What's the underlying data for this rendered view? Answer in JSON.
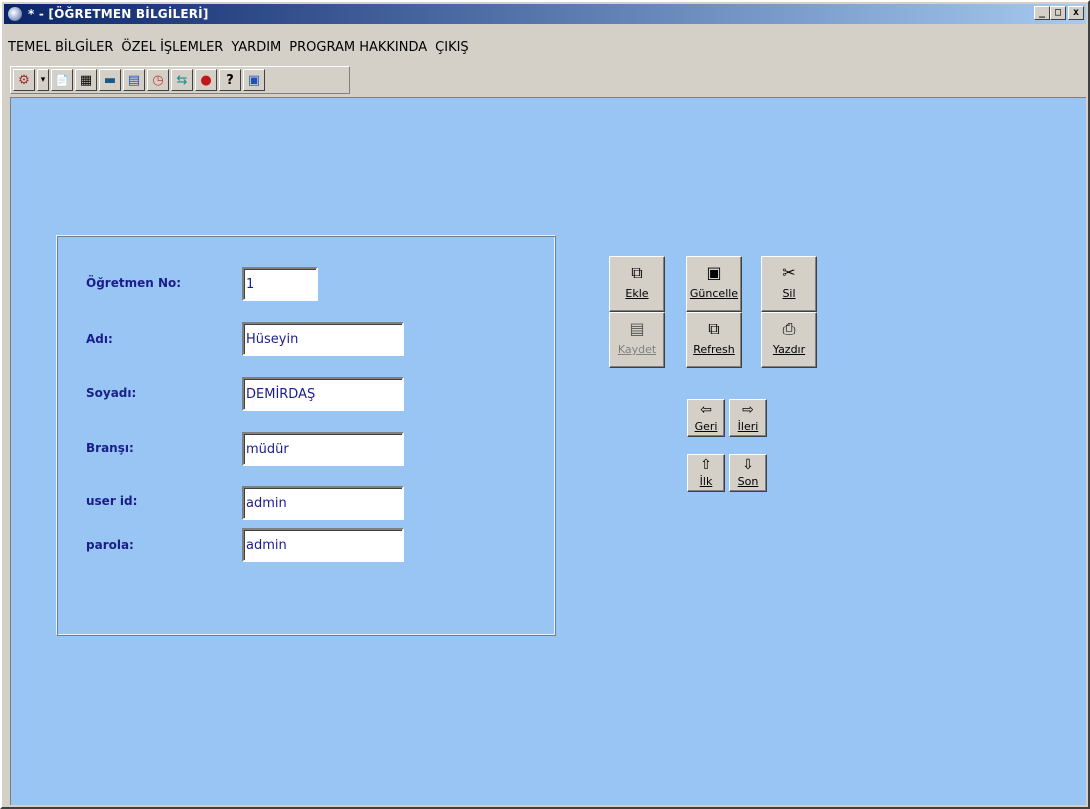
{
  "window": {
    "title": "* - [ÖĞRETMEN BİLGİLERİ]",
    "min_label": "_",
    "max_label": "□",
    "close_label": "x"
  },
  "menu": [
    "TEMEL BİLGİLER",
    "ÖZEL İŞLEMLER",
    "YARDIM",
    "PROGRAM HAKKINDA",
    "ÇIKIŞ"
  ],
  "toolbar": {
    "icons": [
      "tools-icon",
      "dropdown-arrow-icon",
      "copy-icon",
      "grid-icon",
      "keyboard-icon",
      "calendar-icon",
      "clock-icon",
      "exchange-icon",
      "book-icon",
      "help-icon",
      "window-icon"
    ],
    "glyphs": [
      "⚙",
      "▾",
      "📄",
      "▦",
      "▬",
      "▤",
      "◷",
      "⇆",
      "●",
      "?",
      "▣"
    ]
  },
  "form": {
    "teacher_no_label": "Öğretmen No:",
    "teacher_no_value": "1",
    "name_label": "Adı:",
    "name_value": "Hüseyin",
    "surname_label": "Soyadı:",
    "surname_value": "DEMİRDAŞ",
    "branch_label": "Branşı:",
    "branch_value": "müdür",
    "userid_label": "user id:",
    "userid_value": "admin",
    "password_label": "parola:",
    "password_value": "admin"
  },
  "actions": {
    "add": "Ekle",
    "update": "Güncelle",
    "delete": "Sil",
    "save": "Kaydet",
    "refresh": "Refresh",
    "print": "Yazdır"
  },
  "nav": {
    "prev": "Geri",
    "next": "İleri",
    "first": "İlk",
    "last": "Son"
  },
  "colors": {
    "client_bg": "#99c5f4",
    "label_text": "#1a1e8a",
    "title_grad_start": "#0a246a",
    "title_grad_end": "#a6caf0"
  }
}
